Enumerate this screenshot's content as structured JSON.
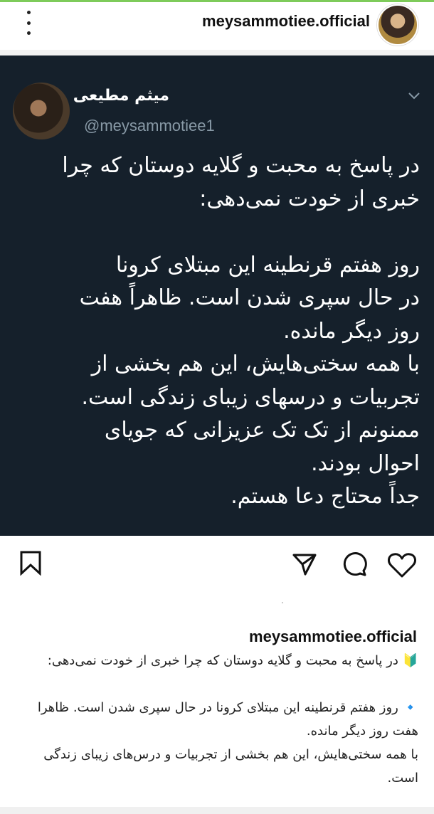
{
  "header": {
    "username": "meysammotiee.official",
    "menu_icon": "more-vertical-icon"
  },
  "tweet": {
    "display_name": "میثم مطیعی",
    "handle": "@meysammotiee1",
    "text": "در پاسخ به محبت و گلایه دوستان که چرا\nخبری از خودت نمی‌دهی:\n\nروز هفتم قرنطینه این مبتلای کرونا\nدر حال سپری شدن است. ظاهراً هفت\nروز دیگر مانده.\nبا همه سختی‌هایش، این هم بخشی از\nتجربیات و درسهای زیبای زندگی است.\nممنونم از تک تک عزیزانی که جویای\nاحوال بودند.\nجداً محتاج دعا هستم."
  },
  "actions": {
    "save_icon": "bookmark-icon",
    "share_icon": "send-icon",
    "comment_icon": "comment-icon",
    "like_icon": "heart-icon"
  },
  "caption": {
    "username": "meysammotiee.official",
    "text": "🔰 در پاسخ به محبت و گلایه دوستان که چرا خبری از خودت نمی‌دهی:\n\n🔹 روز هفتم قرنطینه این مبتلای کرونا در حال سپری شدن است. ظاهرا هفت روز دیگر مانده.\nبا همه سختی‌هایش، این هم بخشی از تجربیات و درس‌های زیبای زندگی است."
  },
  "colors": {
    "tweet_bg": "#15202b",
    "handle": "#8899a6"
  }
}
